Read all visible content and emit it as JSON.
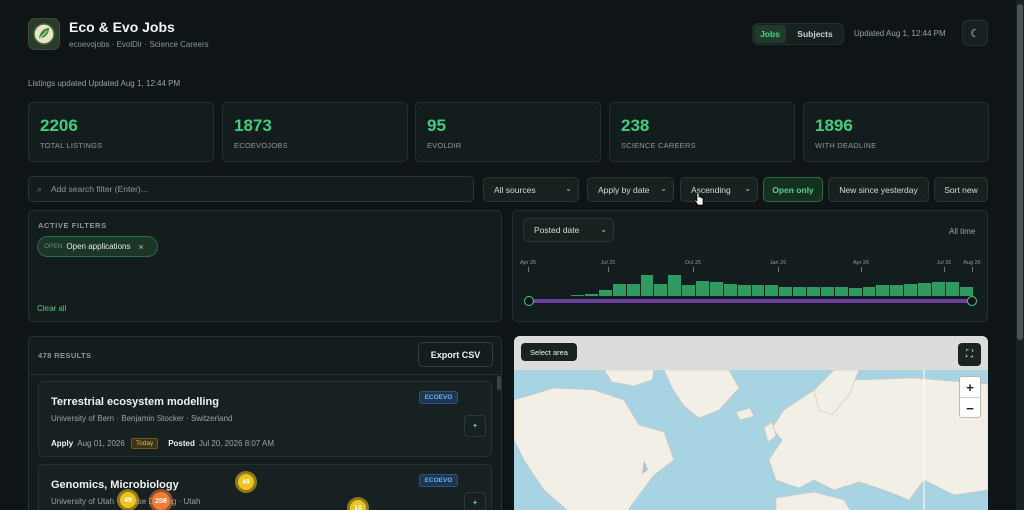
{
  "header": {
    "title": "Eco & Evo Jobs",
    "subtitle": "ecoevojobs · EvolDir · Science Careers",
    "nav": [
      "Jobs",
      "Subjects"
    ],
    "updated": "Updated Aug 1, 12:44 PM",
    "theme_icon": "moon-icon"
  },
  "listings_updated": "Listings updated Updated Aug 1, 12:44 PM",
  "stats": [
    {
      "value": "2206",
      "label": "TOTAL LISTINGS"
    },
    {
      "value": "1873",
      "label": "ECOEVOJOBS"
    },
    {
      "value": "95",
      "label": "EVOLDIR"
    },
    {
      "value": "238",
      "label": "SCIENCE CAREERS"
    },
    {
      "value": "1896",
      "label": "WITH DEADLINE"
    }
  ],
  "controls": {
    "search_placeholder": "Add search filter (Enter)...",
    "sources": "All sources",
    "sort_field": "Apply by date",
    "sort_order": "Ascending",
    "open_only": "Open only",
    "new_since": "New since yesterday",
    "sort_new": "Sort new"
  },
  "filters": {
    "label": "ACTIVE FILTERS",
    "chip_tag": "OPEN",
    "chip_text": "Open applications",
    "chip_close": "×",
    "clear_all": "Clear all"
  },
  "timeline": {
    "field": "Posted date",
    "range": "All time",
    "ticks": [
      "Apr 25",
      "Jul 25",
      "Oct 25",
      "Jan 26",
      "Apr 26",
      "Jul 26",
      "Aug 26"
    ],
    "histogram": [
      0,
      0,
      0,
      0.02,
      0.08,
      0.28,
      0.55,
      0.55,
      0.97,
      0.55,
      0.97,
      0.52,
      0.7,
      0.65,
      0.55,
      0.5,
      0.5,
      0.5,
      0.42,
      0.4,
      0.4,
      0.4,
      0.4,
      0.35,
      0.4,
      0.48,
      0.5,
      0.55,
      0.6,
      0.65,
      0.65,
      0.4
    ]
  },
  "results": {
    "count": "478 RESULTS",
    "export": "Export CSV",
    "jobs": [
      {
        "title": "Terrestrial ecosystem modelling",
        "sub": "University of Bern · Benjamin Stocker · Switzerland",
        "badge": "ECOEVO",
        "apply_label": "Apply",
        "apply_date": "Aug 01, 2026",
        "today": "Today",
        "posted_label": "Posted",
        "posted_date": "Jul 20, 2026 8:07 AM"
      },
      {
        "title": "Genomics, Microbiology",
        "sub": "University of Utah · Denise Dearing · Utah",
        "badge": "ECOEVO"
      }
    ]
  },
  "map": {
    "select_area": "Select area",
    "zoom_in": "+",
    "zoom_out": "−",
    "clusters": [
      {
        "label": "49",
        "color": "#f0c419"
      },
      {
        "label": "208",
        "color": "#ef7d3a"
      },
      {
        "label": "49",
        "color": "#f0c419"
      },
      {
        "label": "10",
        "color": "#f0c419"
      }
    ]
  },
  "colors": {
    "accent": "#3ecf7e",
    "bar": "#2f9a62",
    "slider": "#6b3f9e",
    "badge": "#6bb0f0"
  }
}
